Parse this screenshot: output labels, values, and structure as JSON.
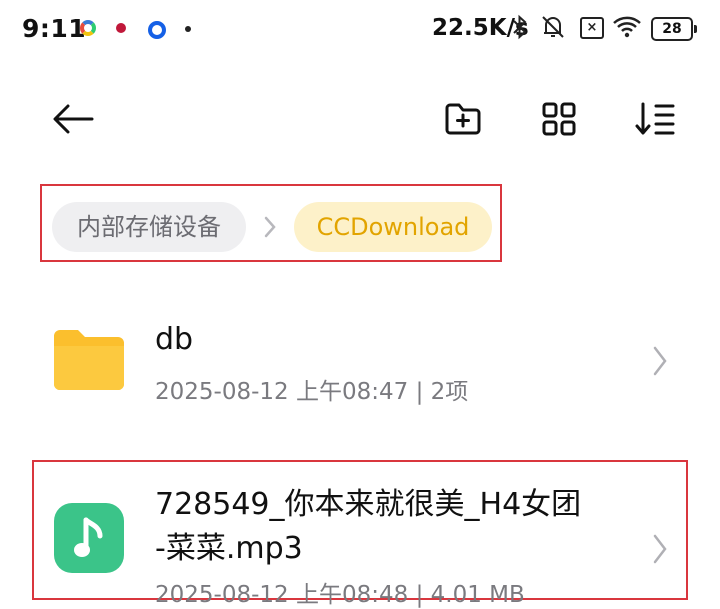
{
  "status_bar": {
    "time": "9:11",
    "net_speed": "22.5K/s",
    "battery": "28",
    "sim_label": "×"
  },
  "toolbar": {
    "icons": [
      "back-arrow-icon",
      "new-folder-icon",
      "grid-view-icon",
      "sort-icon"
    ]
  },
  "breadcrumb": {
    "items": [
      "内部存储设备",
      "CCDownload"
    ],
    "active_color": "#e2a400",
    "active_bg": "#fdf1c9"
  },
  "files": [
    {
      "name": "db",
      "meta": "2025-08-12 上午08:47 | 2项",
      "icon": "folder-icon"
    },
    {
      "name_line1": "728549_你本来就很美_H4女团",
      "name_line2": "-菜菜.mp3",
      "meta": "2025-08-12 上午08:48 | 4.01 MB",
      "icon": "music-file-icon"
    }
  ],
  "colors": {
    "folder": "#fbbf2d",
    "music": "#3bc489",
    "highlight_border": "#d9363e"
  }
}
